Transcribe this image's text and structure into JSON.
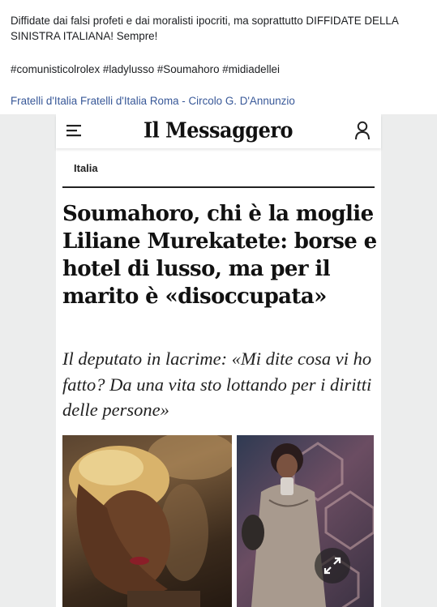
{
  "post": {
    "text": "Diffidate dai falsi profeti e dai moralisti ipocriti, ma soprattutto DIFFIDATE DELLA SINISTRA ITALIANA! Sempre!",
    "hashtags": "#comunisticolrolex #ladylusso #Soumahoro #midiadellei",
    "page_1": "Fratelli d'Italia",
    "page_2": "Fratelli d'Italia Roma - Circolo G. D'Annunzio"
  },
  "article": {
    "logo": "Il Messaggero",
    "section": "Italia",
    "headline": "Soumahoro, chi è la moglie Liliane Murekatete: borse e hotel di lusso, ma per il marito è «disoccupata»",
    "subtitle": "Il deputato in lacrime: «Mi dite cosa vi ho fatto? Da una vita sto lottando per i diritti delle persone»"
  },
  "icons": {
    "menu": "hamburger-menu-icon",
    "user": "user-icon",
    "expand": "expand-icon"
  },
  "colors": {
    "link": "#385898",
    "text": "#1c1e21"
  }
}
